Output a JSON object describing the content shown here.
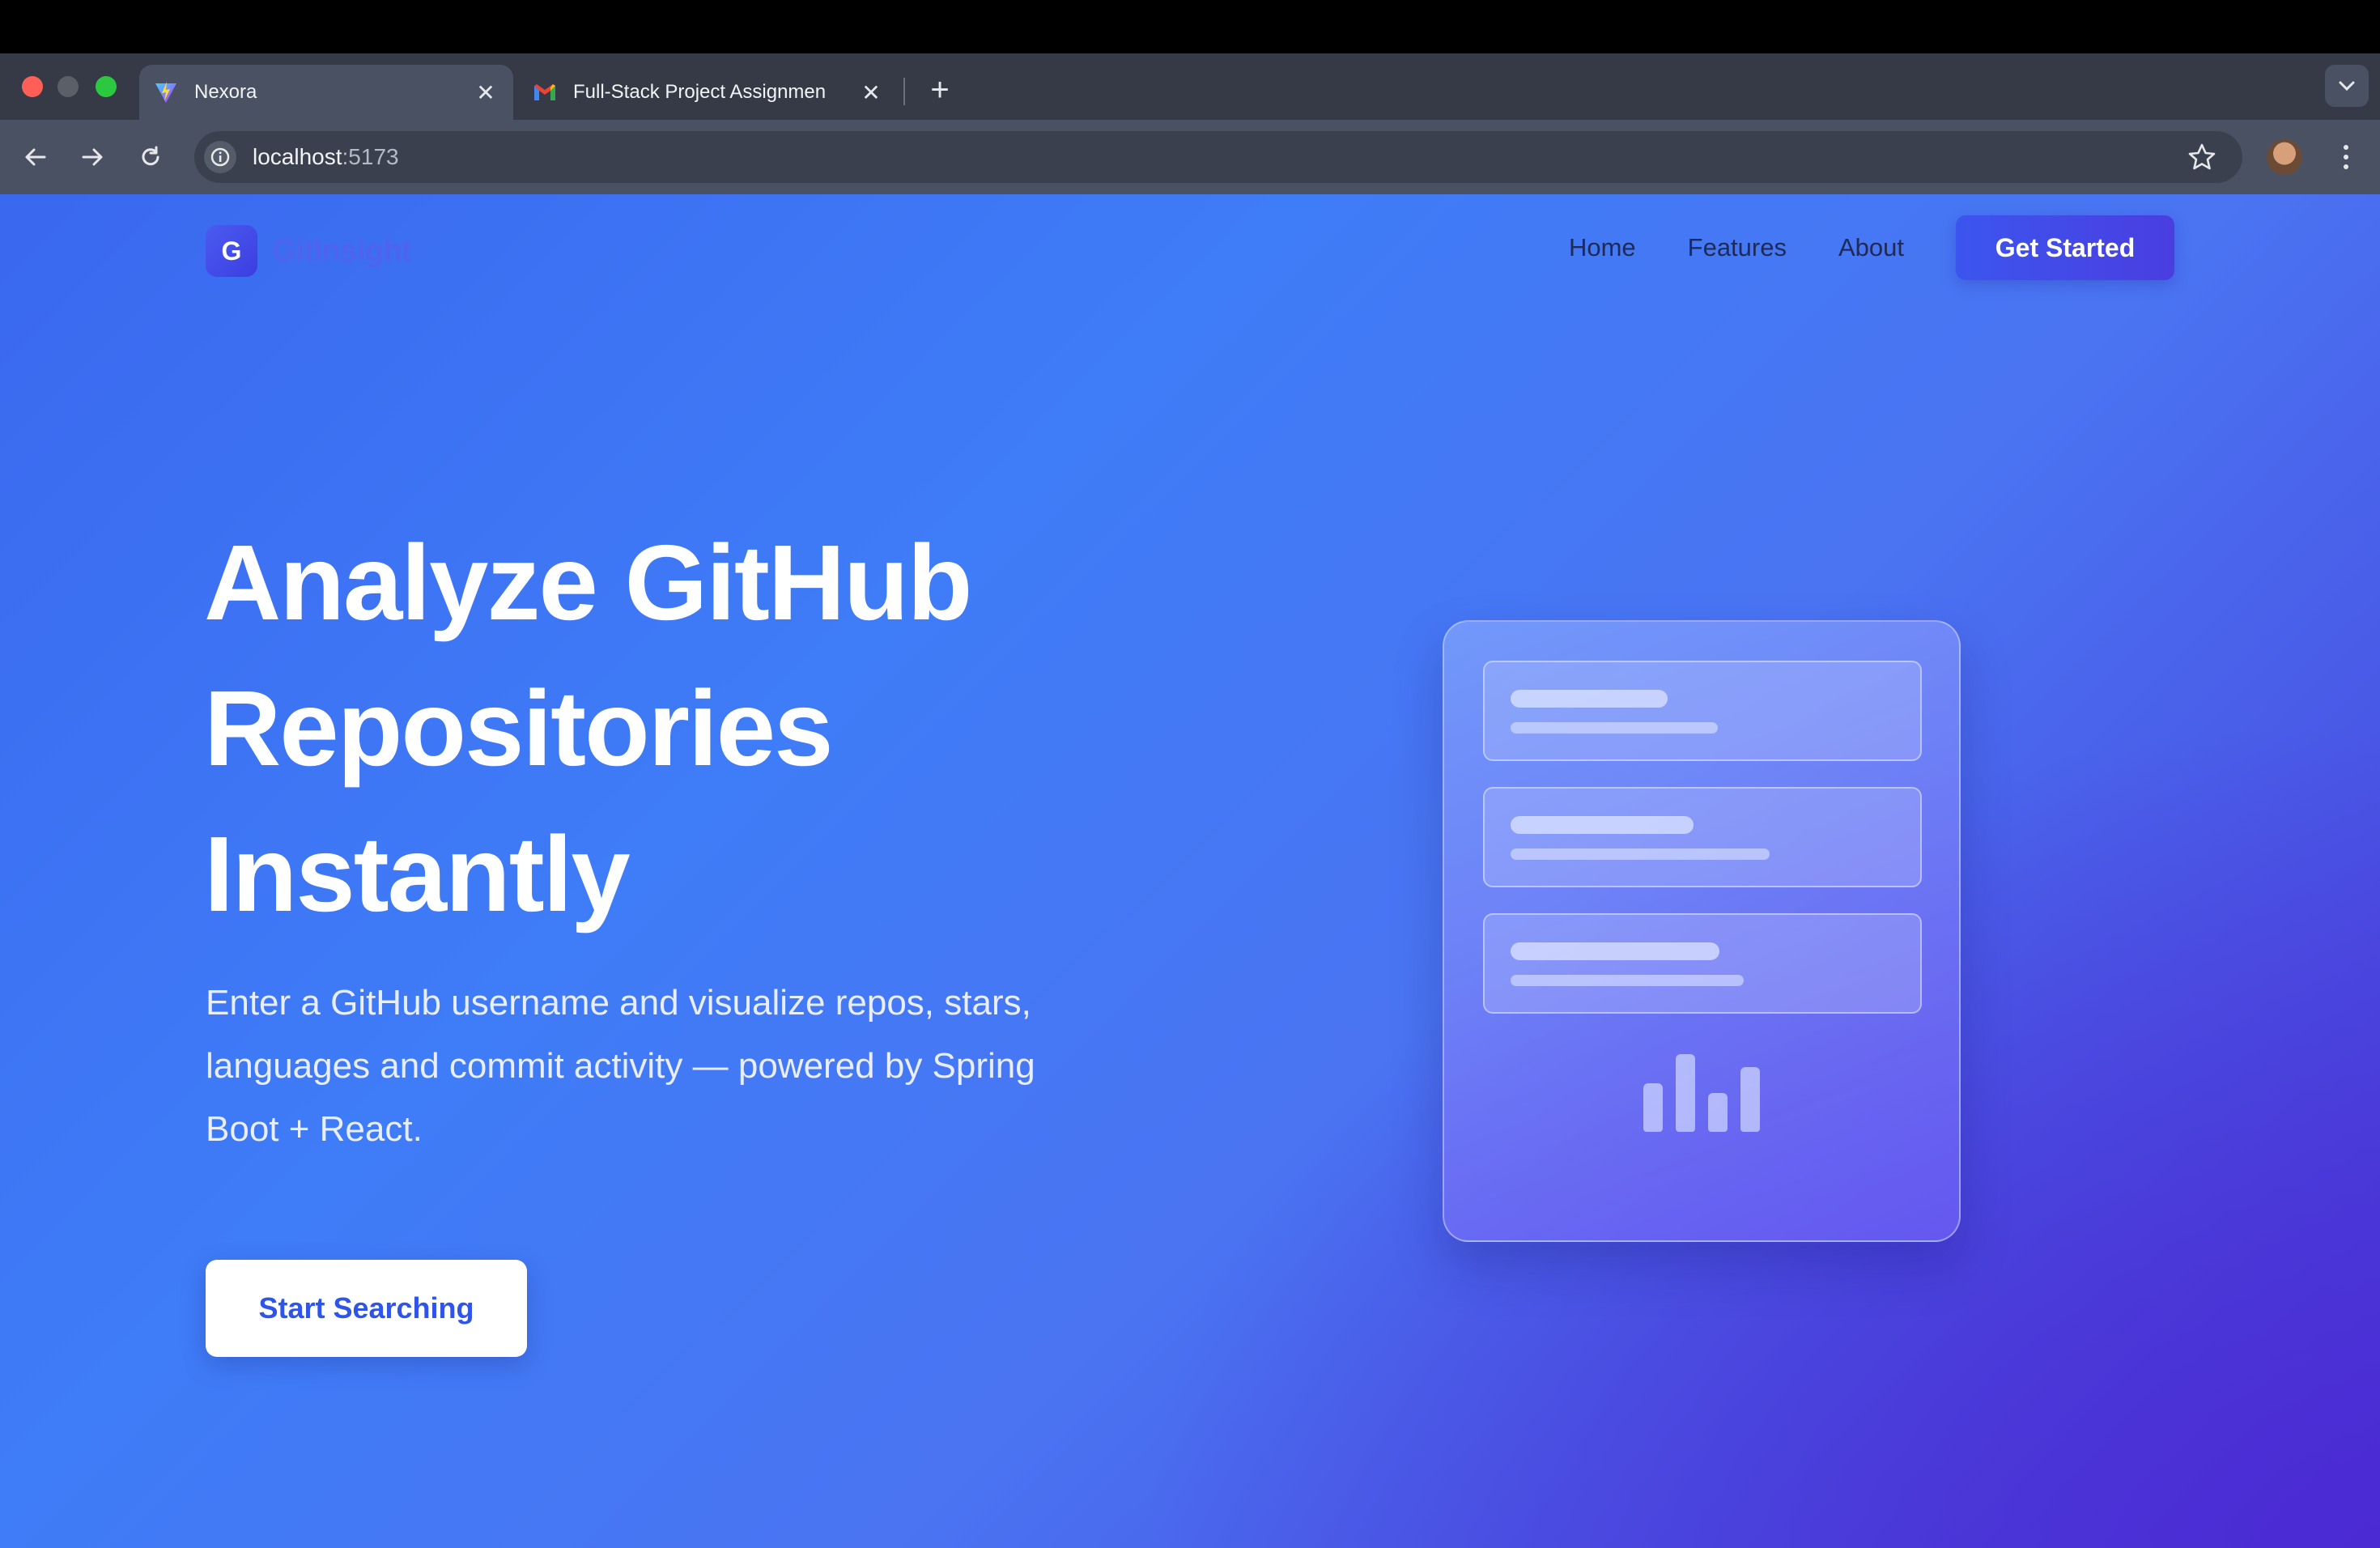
{
  "browser": {
    "tabs": [
      {
        "title": "Nexora",
        "active": true,
        "icon": "vite-icon"
      },
      {
        "title": "Full-Stack Project Assignmen",
        "active": false,
        "icon": "gmail-icon"
      }
    ],
    "close_glyph": "✕",
    "new_tab_glyph": "+",
    "url_host": "localhost",
    "url_port": ":5173"
  },
  "site": {
    "logo_letter": "G",
    "logo_text": "GitInsight",
    "nav": [
      "Home",
      "Features",
      "About"
    ],
    "cta": "Get Started"
  },
  "hero": {
    "title_lines": [
      "Analyze GitHub",
      "Repositories",
      "Instantly"
    ],
    "subtitle": "Enter a GitHub username and visualize repos, stars, languages and commit activity — powered by Spring Boot + React.",
    "button": "Start Searching"
  },
  "colors": {
    "accent": "#3c55ee",
    "page_gradient_start": "#3a68ef",
    "page_gradient_end": "#4836d8"
  }
}
